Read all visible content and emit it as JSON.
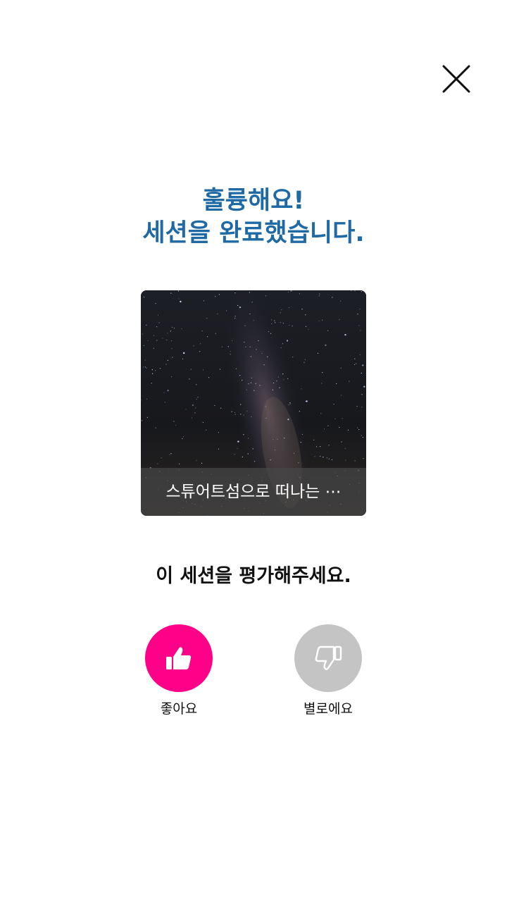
{
  "header": {
    "close_icon": "close-icon"
  },
  "headline": {
    "line1": "훌륭해요!",
    "line2": "세션을 완료했습니다.",
    "color": "#1f6aa5"
  },
  "session_card": {
    "title": "스튜어트섬으로 떠나는 ⋯",
    "image": "milky-way-night-sky"
  },
  "rating": {
    "prompt": "이 세션을 평가해주세요.",
    "like": {
      "label": "좋아요",
      "icon": "thumbs-up-icon",
      "color": "#ff0088"
    },
    "dislike": {
      "label": "별로에요",
      "icon": "thumbs-down-icon",
      "color": "#c4c4c4"
    }
  }
}
